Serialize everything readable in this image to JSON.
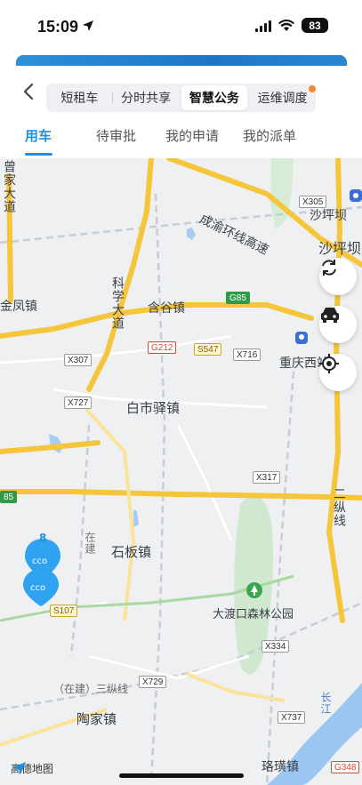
{
  "status_bar": {
    "time": "15:09",
    "battery": "83"
  },
  "nav": {
    "tabs": [
      {
        "label": "短租车"
      },
      {
        "label": "分时共享"
      },
      {
        "label": "智慧公务"
      },
      {
        "label": "运维调度"
      }
    ],
    "active_tab": "智慧公务",
    "sub_tabs": [
      {
        "label": "用车"
      },
      {
        "label": "待审批"
      },
      {
        "label": "我的申请"
      },
      {
        "label": "我的派单"
      }
    ],
    "active_sub_tab": "用车"
  },
  "map": {
    "places": {
      "zengjiadao": "曾家大道",
      "kexuedadao": "科学大道",
      "jinfengzhen": "金凤镇",
      "hanguzhen": "含谷镇",
      "chengyu": "成渝环线高速",
      "shapingba1": "沙坪坝",
      "shapingba2": "沙坪坝",
      "chongqingxi": "重庆西站",
      "baishiyi": "白市驿镇",
      "erzongxian": "二纵线",
      "zaijian": "在建",
      "shibanzhen": "石板镇",
      "dadukou": "大渡口森林公园",
      "sanzong": "（在建）三纵线",
      "taojiazhen": "陶家镇",
      "luoqizhen": "珞璜镇",
      "changjiang": "长江"
    },
    "shields": {
      "x305": "X305",
      "g85": "G85",
      "x307": "X307",
      "g212": "G212",
      "s547": "S547",
      "x716": "X716",
      "x727": "X727",
      "x317": "X317",
      "s107": "S107",
      "x334": "X334",
      "x729": "X729",
      "x737": "X737",
      "s348": "G348",
      "g85b": "85"
    },
    "cluster_count": "8",
    "attribution": "高德地图"
  },
  "colors": {
    "accent": "#1d8fe0",
    "expressway": "#f5c63a",
    "badge": "#f5882d"
  }
}
